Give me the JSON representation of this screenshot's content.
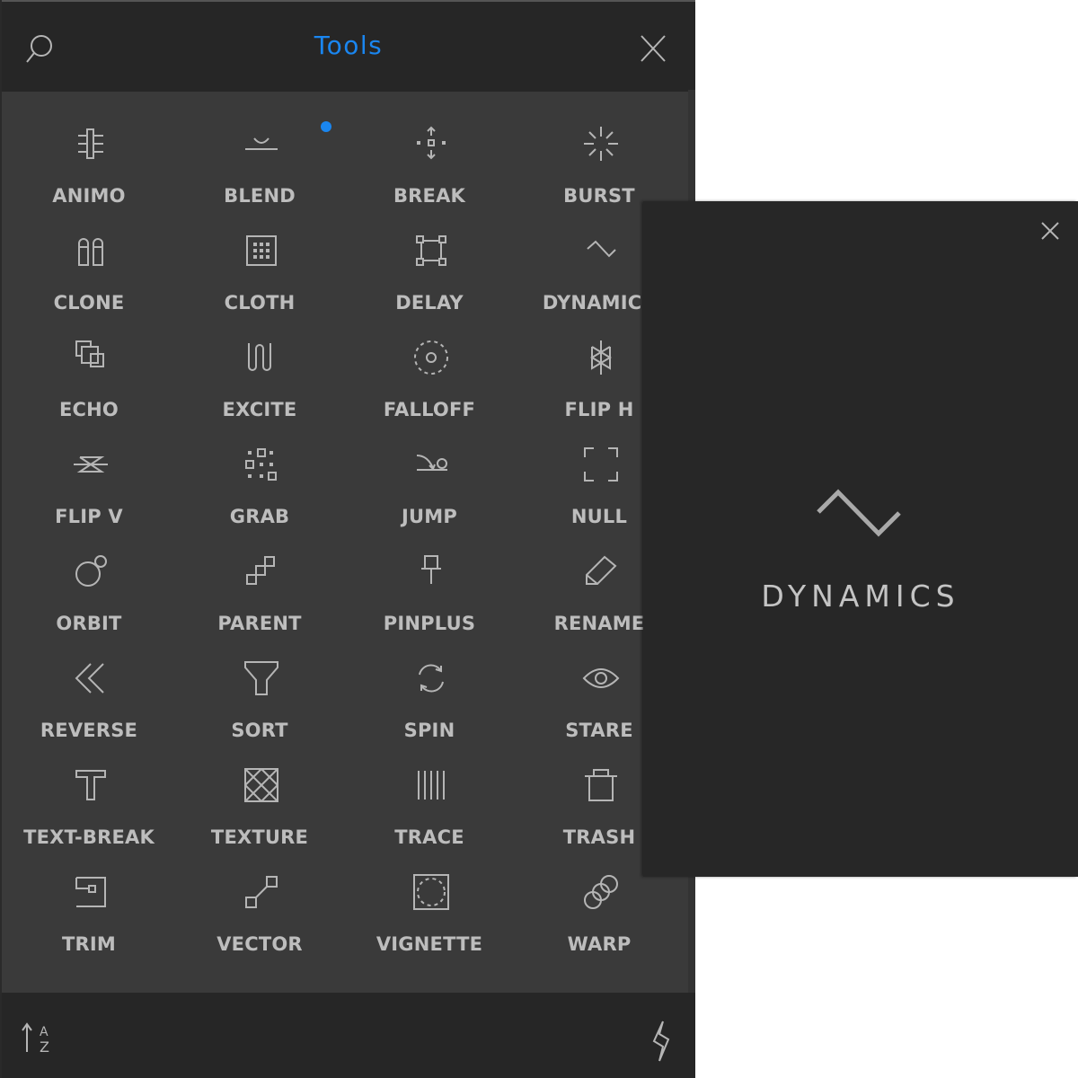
{
  "panel": {
    "title": "Tools",
    "header_icons": {
      "left": "search-icon",
      "right": "close-icon"
    },
    "accent_color": "#1a86f0",
    "badge": {
      "on_tool": "BLEND",
      "color": "#1a86f0"
    },
    "tools": [
      {
        "label": "ANIMO",
        "icon": "animo-icon"
      },
      {
        "label": "BLEND",
        "icon": "blend-icon"
      },
      {
        "label": "BREAK",
        "icon": "break-icon"
      },
      {
        "label": "BURST",
        "icon": "burst-icon"
      },
      {
        "label": "CLONE",
        "icon": "clone-icon"
      },
      {
        "label": "CLOTH",
        "icon": "cloth-icon"
      },
      {
        "label": "DELAY",
        "icon": "delay-icon"
      },
      {
        "label": "DYNAMICS",
        "icon": "dynamics-icon"
      },
      {
        "label": "ECHO",
        "icon": "echo-icon"
      },
      {
        "label": "EXCITE",
        "icon": "excite-icon"
      },
      {
        "label": "FALLOFF",
        "icon": "falloff-icon"
      },
      {
        "label": "FLIP H",
        "icon": "flip-h-icon"
      },
      {
        "label": "FLIP V",
        "icon": "flip-v-icon"
      },
      {
        "label": "GRAB",
        "icon": "grab-icon"
      },
      {
        "label": "JUMP",
        "icon": "jump-icon"
      },
      {
        "label": "NULL",
        "icon": "null-icon"
      },
      {
        "label": "ORBIT",
        "icon": "orbit-icon"
      },
      {
        "label": "PARENT",
        "icon": "parent-icon"
      },
      {
        "label": "PINPLUS",
        "icon": "pin-icon"
      },
      {
        "label": "RENAME",
        "icon": "pencil-icon"
      },
      {
        "label": "REVERSE",
        "icon": "double-chevron-left-icon"
      },
      {
        "label": "SORT",
        "icon": "funnel-icon"
      },
      {
        "label": "SPIN",
        "icon": "rotate-icon"
      },
      {
        "label": "STARE",
        "icon": "eye-icon"
      },
      {
        "label": "TEXT-BREAK",
        "icon": "text-icon"
      },
      {
        "label": "TEXTURE",
        "icon": "texture-icon"
      },
      {
        "label": "TRACE",
        "icon": "trace-icon"
      },
      {
        "label": "TRASH",
        "icon": "trash-icon"
      },
      {
        "label": "TRIM",
        "icon": "trim-icon"
      },
      {
        "label": "VECTOR",
        "icon": "vector-icon"
      },
      {
        "label": "VIGNETTE",
        "icon": "vignette-icon"
      },
      {
        "label": "WARP",
        "icon": "warp-icon"
      }
    ],
    "footer_icons": {
      "left": "sort-az-icon",
      "right": "lightning-icon"
    }
  },
  "popup": {
    "title": "DYNAMICS",
    "icon": "dynamics-icon",
    "close_icon": "close-icon"
  }
}
